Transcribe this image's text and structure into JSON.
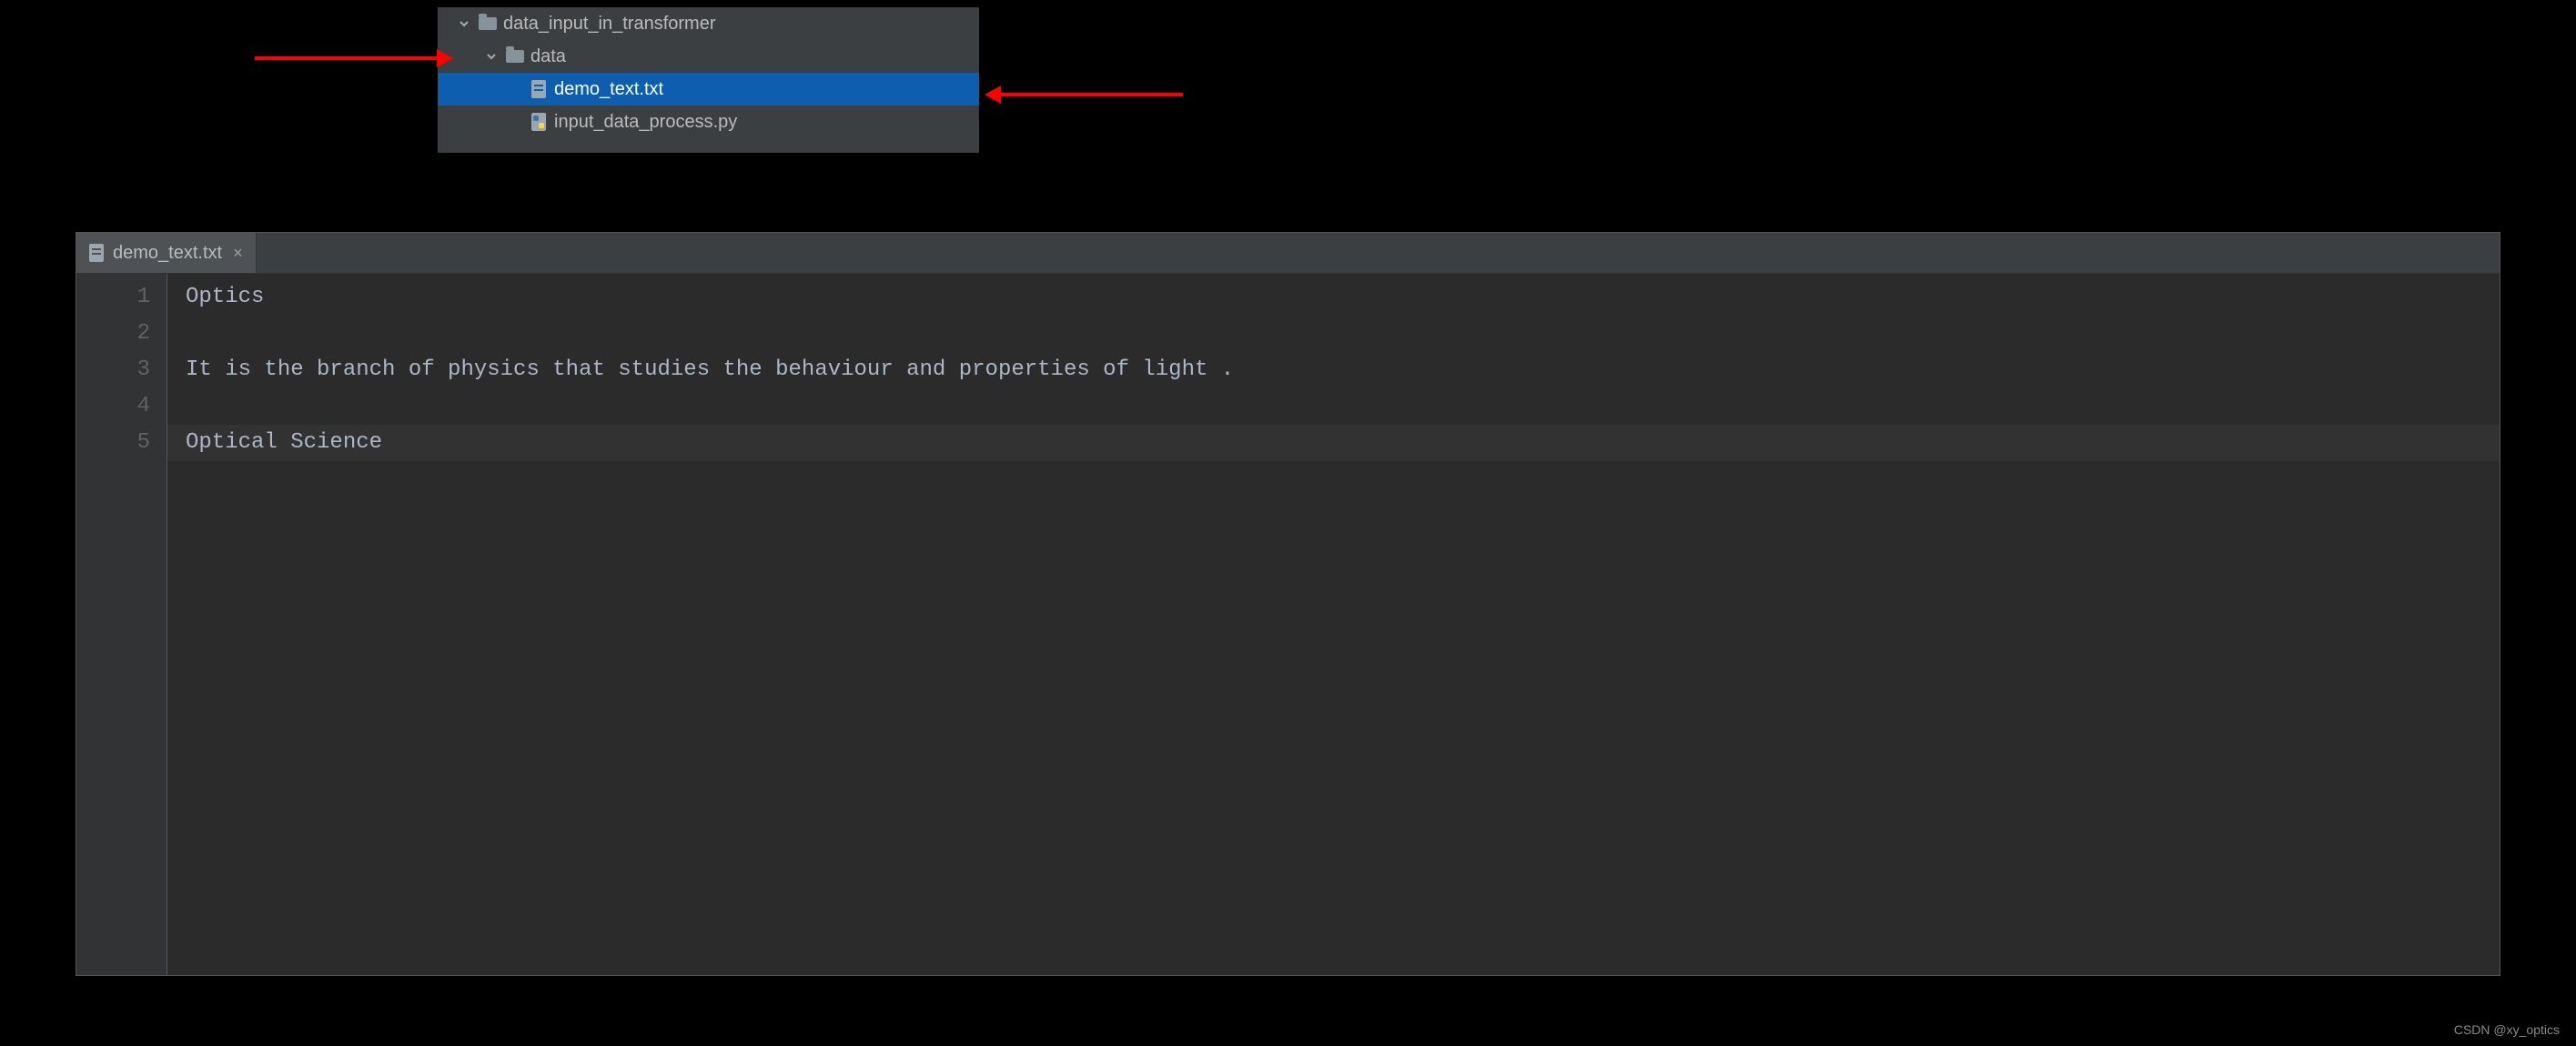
{
  "tree": {
    "items": [
      {
        "label": "data_input_in_transformer",
        "icon": "folder",
        "expanded": true,
        "indent": 0
      },
      {
        "label": "data",
        "icon": "folder",
        "expanded": true,
        "indent": 1
      },
      {
        "label": "demo_text.txt",
        "icon": "file-txt",
        "indent": 2,
        "selected": true
      },
      {
        "label": "input_data_process.py",
        "icon": "file-py",
        "indent": 2
      }
    ]
  },
  "editor": {
    "tab": {
      "label": "demo_text.txt"
    },
    "lines": [
      {
        "num": "1",
        "text": "Optics"
      },
      {
        "num": "2",
        "text": ""
      },
      {
        "num": "3",
        "text": "It is the branch of physics that studies the behaviour and properties of light ."
      },
      {
        "num": "4",
        "text": ""
      },
      {
        "num": "5",
        "text": "Optical Science",
        "current": true
      }
    ]
  },
  "watermark": "CSDN @xy_optics"
}
